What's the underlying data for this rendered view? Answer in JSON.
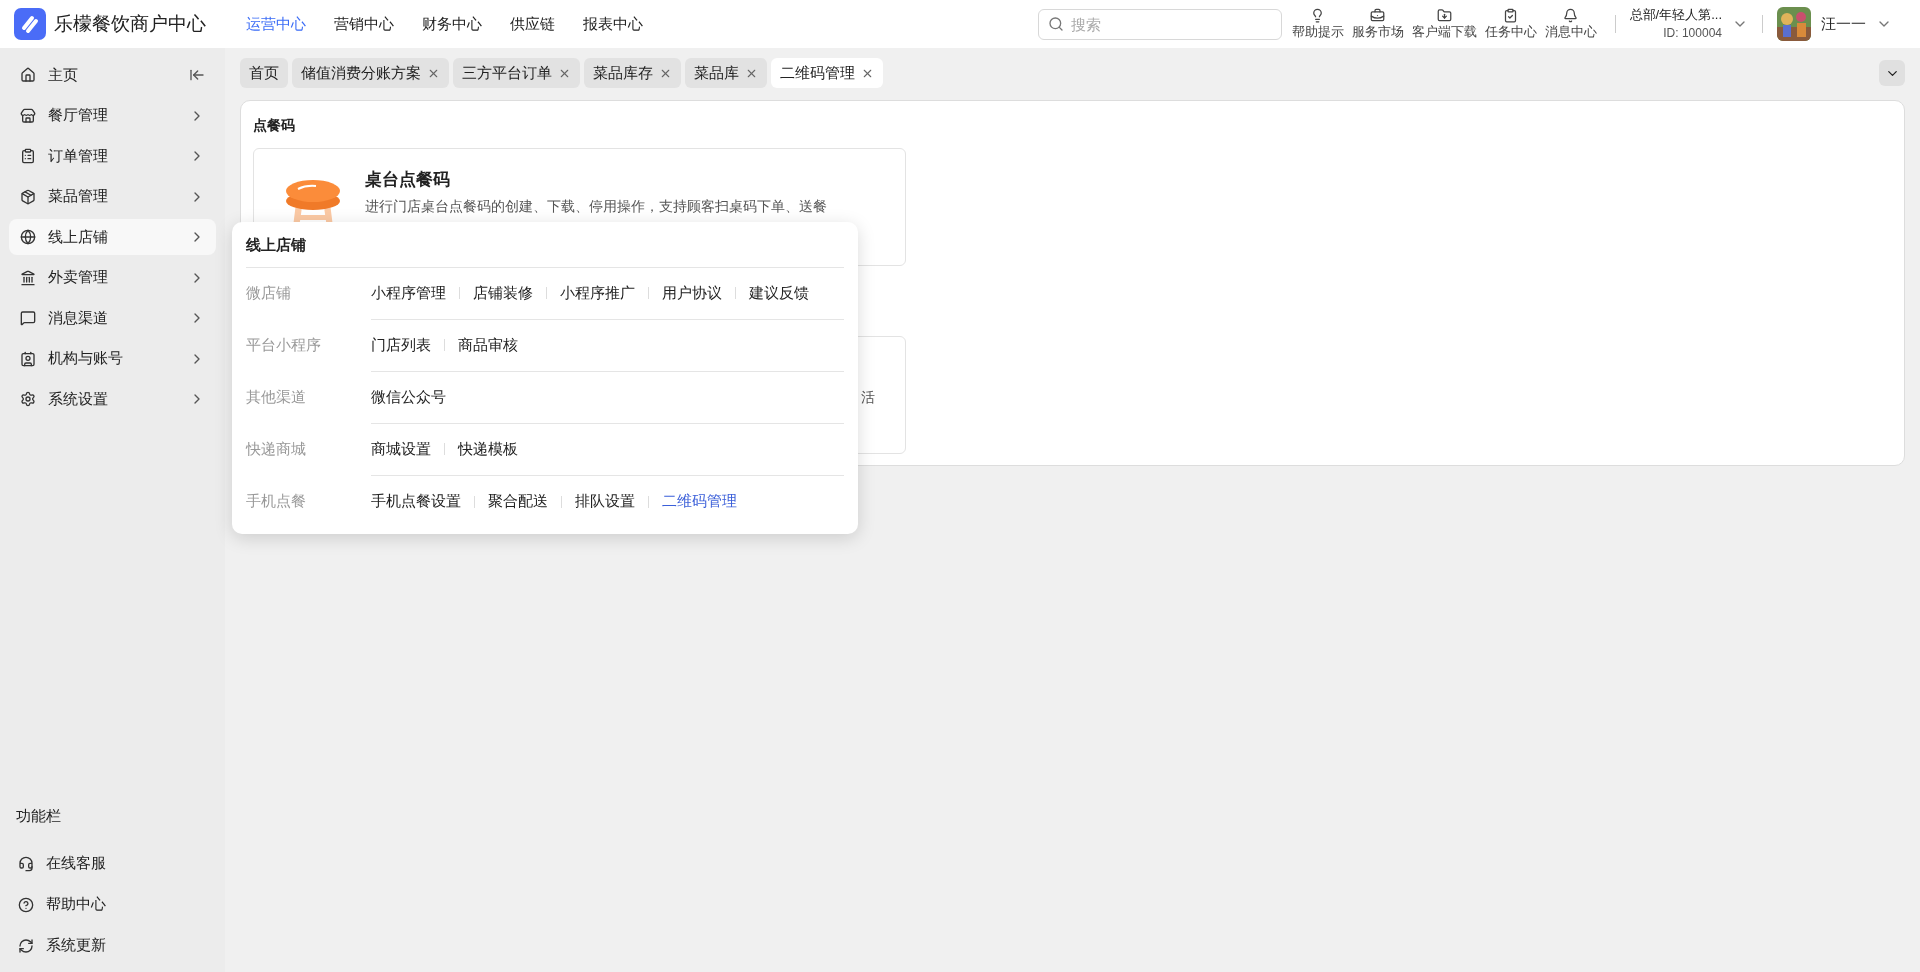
{
  "app": {
    "title": "乐檬餐饮商户中心"
  },
  "top_nav": [
    {
      "label": "运营中心",
      "selected": true
    },
    {
      "label": "营销中心",
      "selected": false
    },
    {
      "label": "财务中心",
      "selected": false
    },
    {
      "label": "供应链",
      "selected": false
    },
    {
      "label": "报表中心",
      "selected": false
    }
  ],
  "search": {
    "placeholder": "搜索"
  },
  "toolbar": [
    {
      "label": "帮助提示"
    },
    {
      "label": "服务市场"
    },
    {
      "label": "客户端下载"
    },
    {
      "label": "任务中心"
    },
    {
      "label": "消息中心"
    }
  ],
  "org": {
    "name": "总部/年轻人第...",
    "id": "ID: 100004"
  },
  "user": {
    "name": "汪一一"
  },
  "sidebar": {
    "items": [
      {
        "label": "主页",
        "selected": false
      },
      {
        "label": "餐厅管理",
        "selected": false
      },
      {
        "label": "订单管理",
        "selected": false
      },
      {
        "label": "菜品管理",
        "selected": false
      },
      {
        "label": "线上店铺",
        "selected": true
      },
      {
        "label": "外卖管理",
        "selected": false
      },
      {
        "label": "消息渠道",
        "selected": false
      },
      {
        "label": "机构与账号",
        "selected": false
      },
      {
        "label": "系统设置",
        "selected": false
      }
    ],
    "footer_title": "功能栏",
    "footer_items": [
      {
        "label": "在线客服"
      },
      {
        "label": "帮助中心"
      },
      {
        "label": "系统更新"
      }
    ]
  },
  "tabs": [
    {
      "label": "首页",
      "selected": false,
      "closable": false
    },
    {
      "label": "储值消费分账方案",
      "selected": false,
      "closable": true
    },
    {
      "label": "三方平台订单",
      "selected": false,
      "closable": true
    },
    {
      "label": "菜品库存",
      "selected": false,
      "closable": true
    },
    {
      "label": "菜品库",
      "selected": false,
      "closable": true
    },
    {
      "label": "二维码管理",
      "selected": true,
      "closable": true
    }
  ],
  "content": {
    "section_title": "点餐码",
    "cards": [
      {
        "title": "桌台点餐码",
        "description": "进行门店桌台点餐码的创建、下载、停用操作，支持顾客扫桌码下单、送餐"
      },
      {
        "description": "活"
      }
    ]
  },
  "flyout": {
    "title": "线上店铺",
    "groups": [
      {
        "label": "微店铺",
        "links": [
          {
            "label": "小程序管理",
            "selected": false
          },
          {
            "label": "店铺装修",
            "selected": false
          },
          {
            "label": "小程序推广",
            "selected": false
          },
          {
            "label": "用户协议",
            "selected": false
          },
          {
            "label": "建议反馈",
            "selected": false
          }
        ]
      },
      {
        "label": "平台小程序",
        "links": [
          {
            "label": "门店列表",
            "selected": false
          },
          {
            "label": "商品审核",
            "selected": false
          }
        ]
      },
      {
        "label": "其他渠道",
        "links": [
          {
            "label": "微信公众号",
            "selected": false
          }
        ]
      },
      {
        "label": "快递商城",
        "links": [
          {
            "label": "商城设置",
            "selected": false
          },
          {
            "label": "快递模板",
            "selected": false
          }
        ]
      },
      {
        "label": "手机点餐",
        "links": [
          {
            "label": "手机点餐设置",
            "selected": false
          },
          {
            "label": "聚合配送",
            "selected": false
          },
          {
            "label": "排队设置",
            "selected": false
          },
          {
            "label": "二维码管理",
            "selected": true
          }
        ]
      }
    ]
  }
}
